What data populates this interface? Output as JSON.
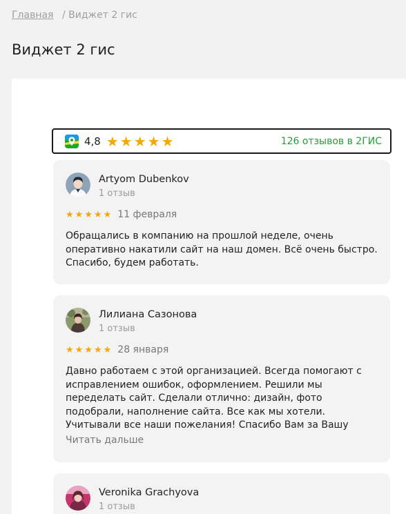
{
  "breadcrumb": {
    "home_label": "Главная",
    "separator": "/",
    "current_label": "Виджет 2 гис"
  },
  "page": {
    "title": "Виджет 2 гис"
  },
  "widget": {
    "logo_icon": "2gis-logo-icon",
    "rating": "4,8",
    "rating_stars": 5,
    "reviews_link": "126 отзывов в 2ГИС",
    "accent_color": "#21a038",
    "star_color": "#f2a900"
  },
  "reviews": [
    {
      "author": "Artyom Dubenkov",
      "author_reviews": "1 отзыв",
      "stars": 5,
      "date": "11 февраля",
      "text": "Обращались в компанию на прошлой неделе, очень оперативно накатили сайт на наш домен. Всё очень быстро. Спасибо, будем работать."
    },
    {
      "author": "Лилиана Сазонова",
      "author_reviews": "1 отзыв",
      "stars": 5,
      "date": "28 января",
      "text": "Давно работаем с этой организацией. Всегда помогают с исправлением ошибок, оформлением. Решили мы переделать сайт. Сделали отлично: дизайн, фото подобрали, наполнение сайта. Все как мы хотели. Учитывали все наши пожелания! Спасибо Вам за Вашу",
      "read_more": "Читать дальше"
    },
    {
      "author": "Veronika Grachyova",
      "author_reviews": "1 отзыв"
    }
  ]
}
